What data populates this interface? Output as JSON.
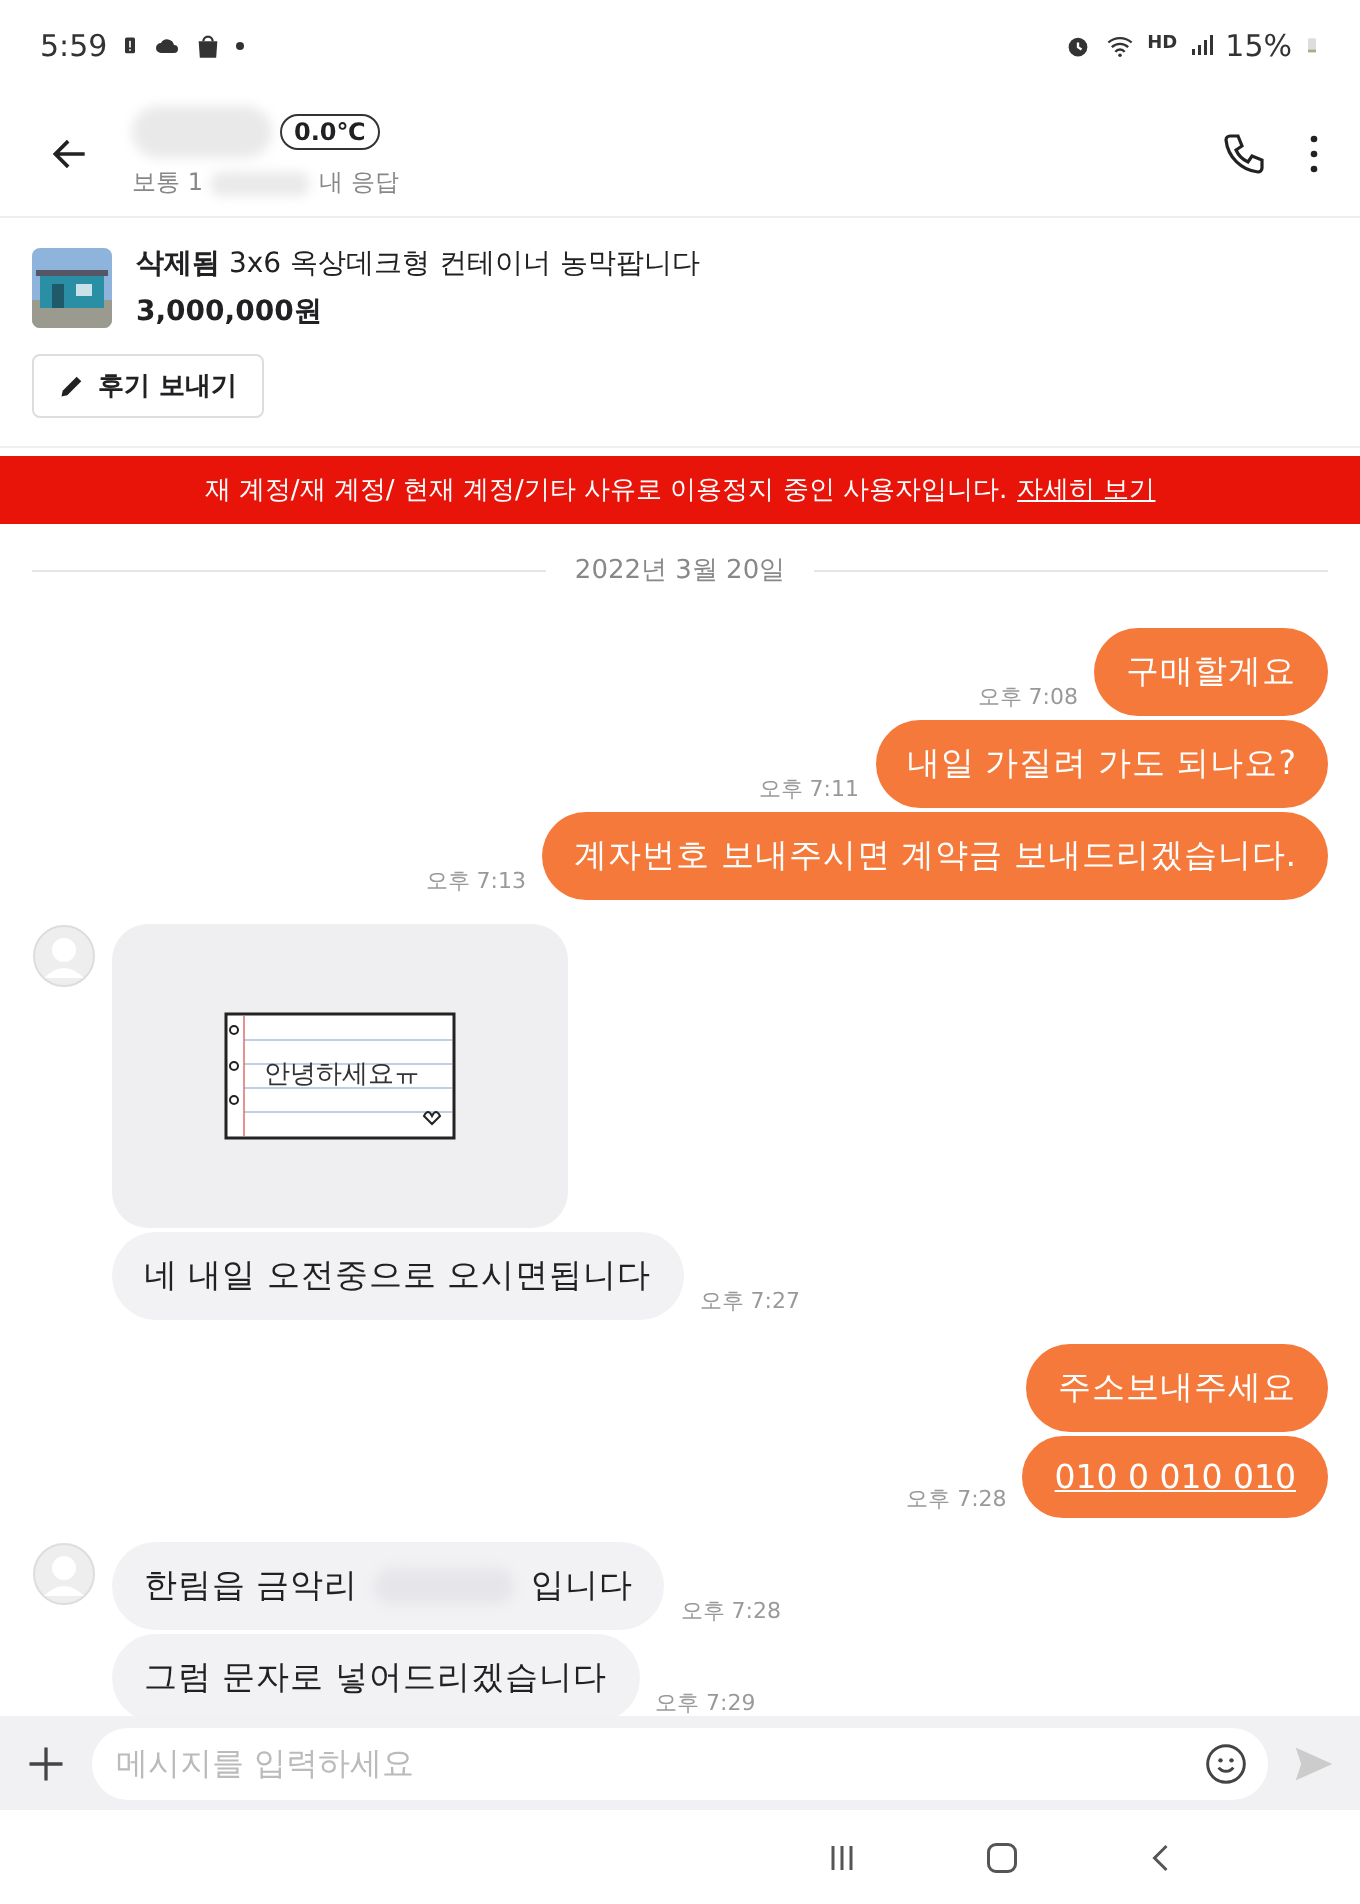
{
  "status_bar": {
    "time": "5:59",
    "hd_label": "HD",
    "battery": "15%"
  },
  "header": {
    "temperature": "0.0℃",
    "subtitle_start": "보통 1",
    "subtitle_end": "내 응답"
  },
  "product": {
    "status": "삭제됨",
    "title": "3x6 옥상데크형 컨테이너 농막팝니다",
    "price": "3,000,000원",
    "review_button": "후기 보내기"
  },
  "banner": {
    "text": "재 계정/재 계정/ 현재 계정/기타 사유로 이용정지 중인 사용자입니다.",
    "link": "자세히 보기"
  },
  "messages": [
    {
      "kind": "date",
      "text": "2022년 3월 20일"
    },
    {
      "kind": "out",
      "text": "구매할게요",
      "time": "오후 7:08"
    },
    {
      "kind": "out",
      "text": "내일 가질려 가도 되나요?",
      "time": "오후 7:11"
    },
    {
      "kind": "out",
      "text": "계자번호 보내주시면 계약금 보내드리겠습니다.",
      "time": "오후 7:13"
    },
    {
      "kind": "sticker",
      "text": "안녕하세요ㅠ",
      "avatar": true
    },
    {
      "kind": "in",
      "text": "네 내일 오전중으로 오시면됩니다",
      "time": "오후 7:27",
      "avatar": false
    },
    {
      "kind": "out",
      "text": "주소보내주세요"
    },
    {
      "kind": "out-link",
      "text": "010 0 010 010",
      "time": "오후 7:28"
    },
    {
      "kind": "in",
      "text": "한림읍 금악리",
      "text_end": "입니다",
      "time": "오후 7:28",
      "avatar": true
    },
    {
      "kind": "in",
      "text": "그럼 문자로 넣어드리겠습니다",
      "time": "오후 7:29",
      "avatar": false
    }
  ],
  "composer": {
    "placeholder": "메시지를 입력하세요"
  }
}
